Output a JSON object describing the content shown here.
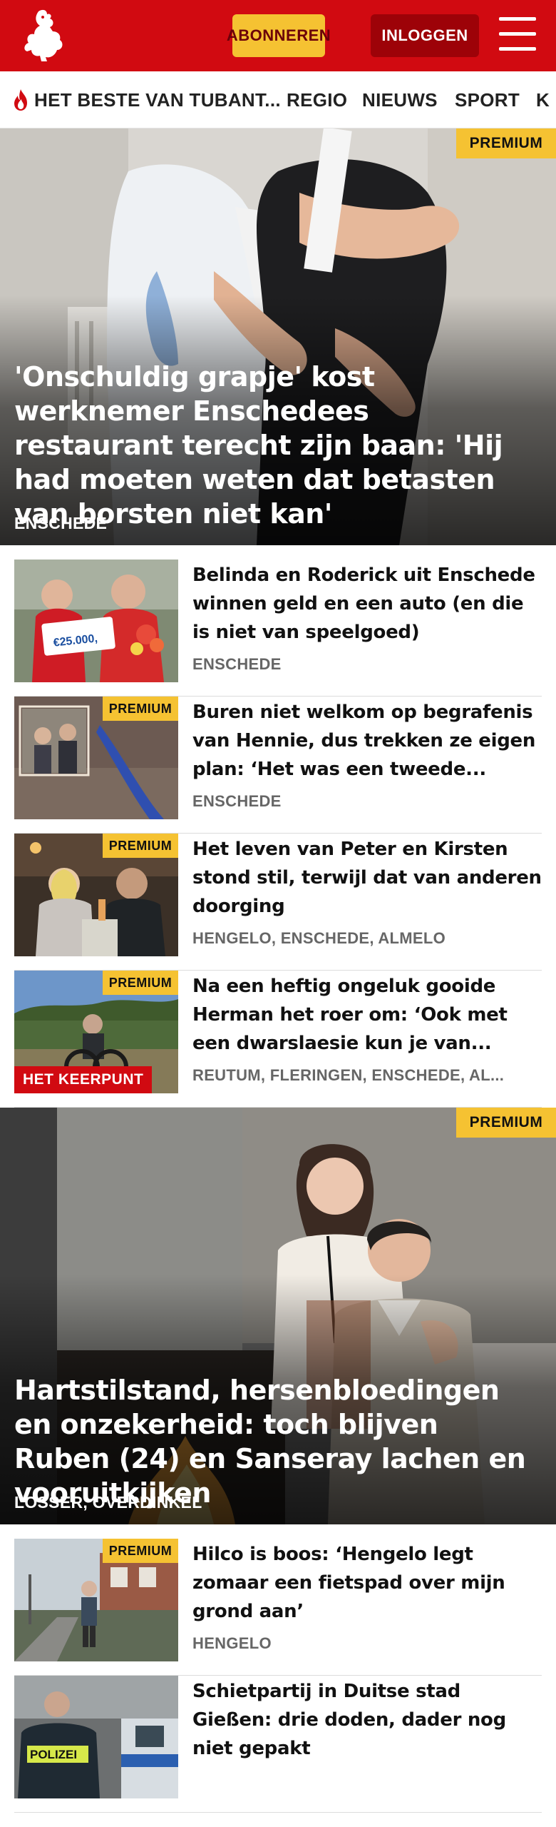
{
  "header": {
    "logo_alt": "Tubantia logo",
    "subscribe_label": "ABONNEREN",
    "login_label": "INLOGGEN",
    "menu_icon": "hamburger-menu-icon",
    "brand_color": "#d10a11"
  },
  "nav": {
    "items": [
      {
        "label": "HET BESTE VAN TUBANT...",
        "icon": "flame-icon"
      },
      {
        "label": "REGIO"
      },
      {
        "label": "NIEUWS"
      },
      {
        "label": "SPORT"
      },
      {
        "label": "K"
      }
    ]
  },
  "premium_label": "PREMIUM",
  "hero1": {
    "title": "'Onschuldig grapje' kost werknemer Enschedees restaurant terecht zijn baan: 'Hij had moeten weten dat betasten van borsten niet kan'",
    "location": "ENSCHEDE",
    "premium": true
  },
  "articles_a": [
    {
      "title": "Belinda en Roderick uit Enschede winnen geld en een auto (en die is niet van speelgoed)",
      "location": "ENSCHEDE",
      "premium": false,
      "thumb_text": "€25.000,"
    },
    {
      "title": "Buren niet welkom op begrafenis van Hennie, dus trekken ze eigen plan: ‘Het was een tweede...",
      "location": "ENSCHEDE",
      "premium": true
    },
    {
      "title": "Het leven van Peter en Kirsten stond stil, terwijl dat van anderen doorging",
      "location": "HENGELO, ENSCHEDE, ALMELO",
      "premium": true
    },
    {
      "title": "Na een heftig ongeluk gooide Herman het roer om: ‘Ook met een dwarslaesie kun je van...",
      "location": "REUTUM, FLERINGEN, ENSCHEDE, AL...",
      "premium": true,
      "label": "HET KEERPUNT"
    }
  ],
  "hero2": {
    "title": "Hartstilstand, hersenbloedingen en onzekerheid: toch blijven Ruben (24) en Sanseray lachen en vooruitkijken",
    "location": "LOSSER, OVERDINKEL",
    "premium": true
  },
  "articles_b": [
    {
      "title": "Hilco is boos: ‘Hengelo legt zomaar een fietspad over mijn grond aan’",
      "location": "HENGELO",
      "premium": true
    },
    {
      "title": "Schietpartij in Duitse stad Gießen: drie doden, dader nog niet gepakt",
      "location": "",
      "premium": false,
      "thumb_text": "POLIZEI"
    }
  ]
}
